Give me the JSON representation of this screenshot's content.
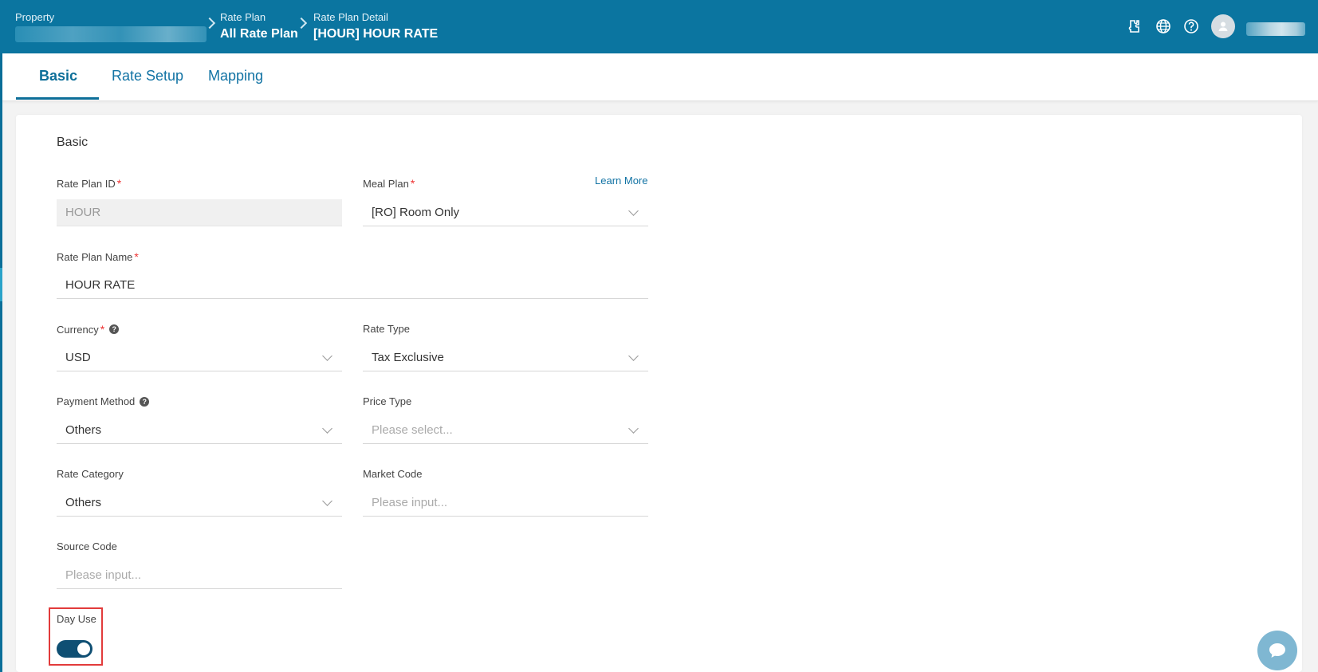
{
  "header": {
    "property_label": "Property",
    "crumb1_label": "Rate Plan",
    "crumb1_value": "All Rate Plan",
    "crumb2_label": "Rate Plan Detail",
    "crumb2_value": "[HOUR] HOUR RATE",
    "icons": [
      "plugin-icon",
      "globe-icon",
      "help-icon",
      "user-avatar-icon"
    ]
  },
  "tabs": [
    {
      "label": "Basic",
      "active": true
    },
    {
      "label": "Rate Setup",
      "active": false
    },
    {
      "label": "Mapping",
      "active": false
    }
  ],
  "form": {
    "section_title": "Basic",
    "learn_more": "Learn More",
    "rate_plan_id": {
      "label": "Rate Plan ID",
      "value": "HOUR"
    },
    "meal_plan": {
      "label": "Meal Plan",
      "value": "[RO] Room Only"
    },
    "rate_plan_name": {
      "label": "Rate Plan Name",
      "value": "HOUR RATE"
    },
    "currency": {
      "label": "Currency",
      "value": "USD"
    },
    "rate_type": {
      "label": "Rate Type",
      "value": "Tax Exclusive"
    },
    "payment_method": {
      "label": "Payment Method",
      "value": "Others"
    },
    "price_type": {
      "label": "Price Type",
      "placeholder": "Please select..."
    },
    "rate_category": {
      "label": "Rate Category",
      "value": "Others"
    },
    "market_code": {
      "label": "Market Code",
      "placeholder": "Please input..."
    },
    "source_code": {
      "label": "Source Code",
      "placeholder": "Please input..."
    },
    "day_use": {
      "label": "Day Use",
      "enabled": true
    }
  },
  "colors": {
    "header_bg": "#0b75a0",
    "accent": "#1273a4",
    "toggle_on": "#0f4f73",
    "required": "#e33333",
    "highlight_box": "#e23b3b"
  }
}
